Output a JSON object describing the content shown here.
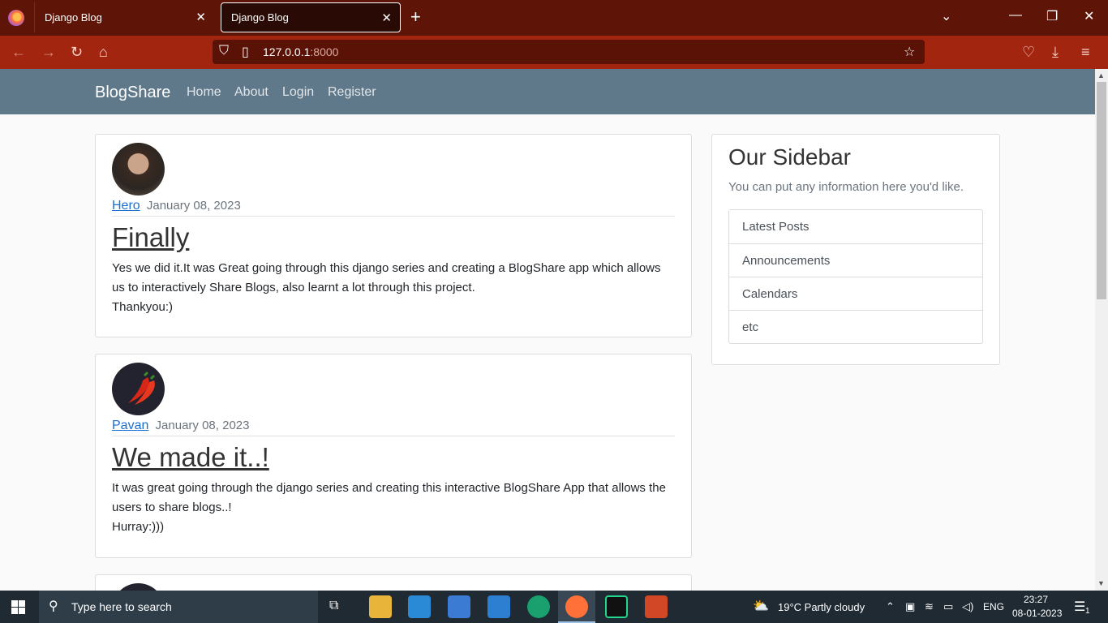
{
  "browser": {
    "tabs": [
      {
        "title": "Django Blog",
        "active": false
      },
      {
        "title": "Django Blog",
        "active": true
      }
    ],
    "url_host": "127.0.0.1",
    "url_port": ":8000"
  },
  "site": {
    "brand": "BlogShare",
    "nav": [
      "Home",
      "About",
      "Login",
      "Register"
    ]
  },
  "posts": [
    {
      "author": "Hero",
      "date": "January 08, 2023",
      "title": "Finally",
      "body": "Yes we did it.It was Great going through this django series and creating a BlogShare app which allows us to interactively Share Blogs, also learnt a lot through this project.\nThankyou:)"
    },
    {
      "author": "Pavan",
      "date": "January 08, 2023",
      "title": "We made it..!",
      "body": "It was great going through the django series and creating this interactive BlogShare App that allows the users to share blogs..!\nHurray:)))"
    }
  ],
  "sidebar": {
    "title": "Our Sidebar",
    "subtitle": "You can put any information here you'd like.",
    "items": [
      "Latest Posts",
      "Announcements",
      "Calendars",
      "etc"
    ]
  },
  "taskbar": {
    "search_placeholder": "Type here to search",
    "weather": "19°C  Partly cloudy",
    "language": "ENG",
    "time": "23:27",
    "date": "08-01-2023",
    "notification_count": "1"
  }
}
